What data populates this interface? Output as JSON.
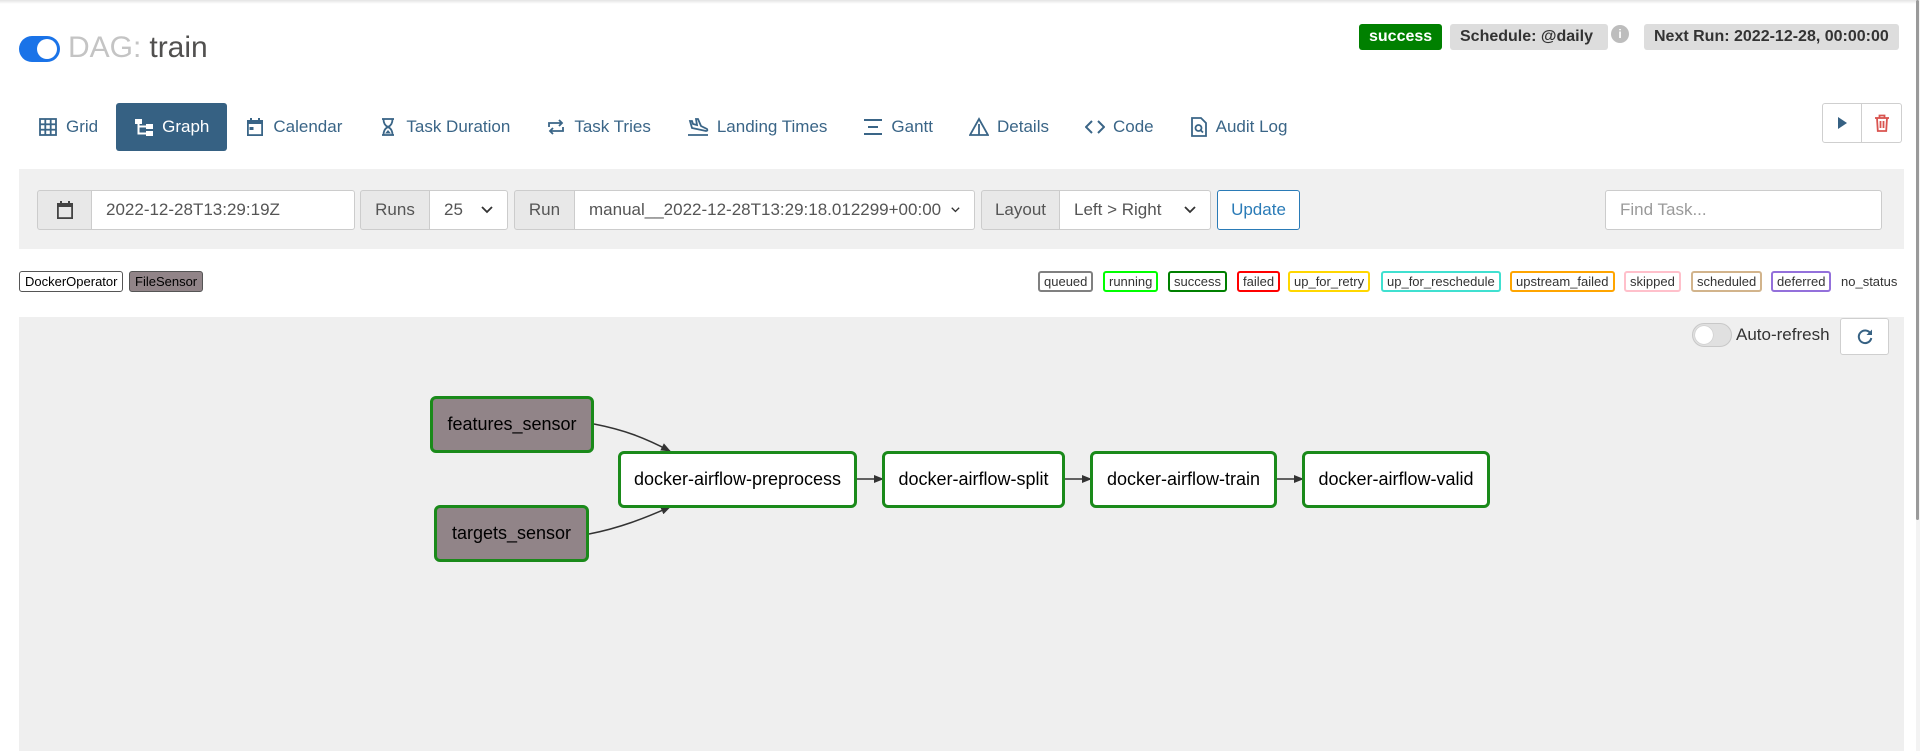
{
  "header": {
    "dag_label": "DAG:",
    "dag_name": "train",
    "state_badge": "success",
    "schedule": "Schedule: @daily",
    "info_icon_glyph": "i",
    "next_run": "Next Run: 2022-12-28, 00:00:00",
    "paused_toggle_on": true
  },
  "tabs": [
    {
      "label": "Grid",
      "icon": "grid-icon"
    },
    {
      "label": "Graph",
      "icon": "graph-icon",
      "active": true
    },
    {
      "label": "Calendar",
      "icon": "calendar-icon"
    },
    {
      "label": "Task Duration",
      "icon": "hourglass-icon"
    },
    {
      "label": "Task Tries",
      "icon": "repeat-icon"
    },
    {
      "label": "Landing Times",
      "icon": "plane-landing-icon"
    },
    {
      "label": "Gantt",
      "icon": "gantt-icon"
    },
    {
      "label": "Details",
      "icon": "warning-triangle-icon"
    },
    {
      "label": "Code",
      "icon": "code-icon"
    },
    {
      "label": "Audit Log",
      "icon": "file-search-icon"
    }
  ],
  "actions": {
    "trigger_icon": "play-icon",
    "delete_icon": "trash-icon"
  },
  "filters": {
    "base_date": "2022-12-28T13:29:19Z",
    "runs_label": "Runs",
    "runs_value": "25",
    "run_label": "Run",
    "run_value": "manual__2022-12-28T13:29:18.012299+00:00",
    "layout_label": "Layout",
    "layout_value": "Left > Right",
    "update_label": "Update",
    "find_placeholder": "Find Task..."
  },
  "operator_legend": [
    {
      "label": "DockerOperator",
      "color": "#ffffff"
    },
    {
      "label": "FileSensor",
      "color": "#918488"
    }
  ],
  "state_legend": [
    {
      "label": "queued",
      "color": "#808080"
    },
    {
      "label": "running",
      "color": "#00ff00"
    },
    {
      "label": "success",
      "color": "#008000"
    },
    {
      "label": "failed",
      "color": "#ff0000"
    },
    {
      "label": "up_for_retry",
      "color": "#ffd700"
    },
    {
      "label": "up_for_reschedule",
      "color": "#40e0d0"
    },
    {
      "label": "upstream_failed",
      "color": "#ffa500"
    },
    {
      "label": "skipped",
      "color": "#ffc0cb"
    },
    {
      "label": "scheduled",
      "color": "#d2b48c"
    },
    {
      "label": "deferred",
      "color": "#9370db"
    },
    {
      "label": "no_status",
      "color": null
    }
  ],
  "graph": {
    "auto_refresh_label": "Auto-refresh",
    "auto_refresh_on": false,
    "nodes": [
      {
        "id": "features_sensor",
        "label": "features_sensor",
        "operator": "FileSensor",
        "state": "success"
      },
      {
        "id": "targets_sensor",
        "label": "targets_sensor",
        "operator": "FileSensor",
        "state": "success"
      },
      {
        "id": "docker-airflow-preprocess",
        "label": "docker-airflow-preprocess",
        "operator": "DockerOperator",
        "state": "success"
      },
      {
        "id": "docker-airflow-split",
        "label": "docker-airflow-split",
        "operator": "DockerOperator",
        "state": "success"
      },
      {
        "id": "docker-airflow-train",
        "label": "docker-airflow-train",
        "operator": "DockerOperator",
        "state": "success"
      },
      {
        "id": "docker-airflow-valid",
        "label": "docker-airflow-valid",
        "operator": "DockerOperator",
        "state": "success"
      }
    ],
    "edges": [
      {
        "from": "features_sensor",
        "to": "docker-airflow-preprocess"
      },
      {
        "from": "targets_sensor",
        "to": "docker-airflow-preprocess"
      },
      {
        "from": "docker-airflow-preprocess",
        "to": "docker-airflow-split"
      },
      {
        "from": "docker-airflow-split",
        "to": "docker-airflow-train"
      },
      {
        "from": "docker-airflow-train",
        "to": "docker-airflow-valid"
      }
    ]
  },
  "colors": {
    "accent": "#366183",
    "success": "#008000",
    "toggle_on": "#1a73e8",
    "update": "#2a7bb7"
  }
}
